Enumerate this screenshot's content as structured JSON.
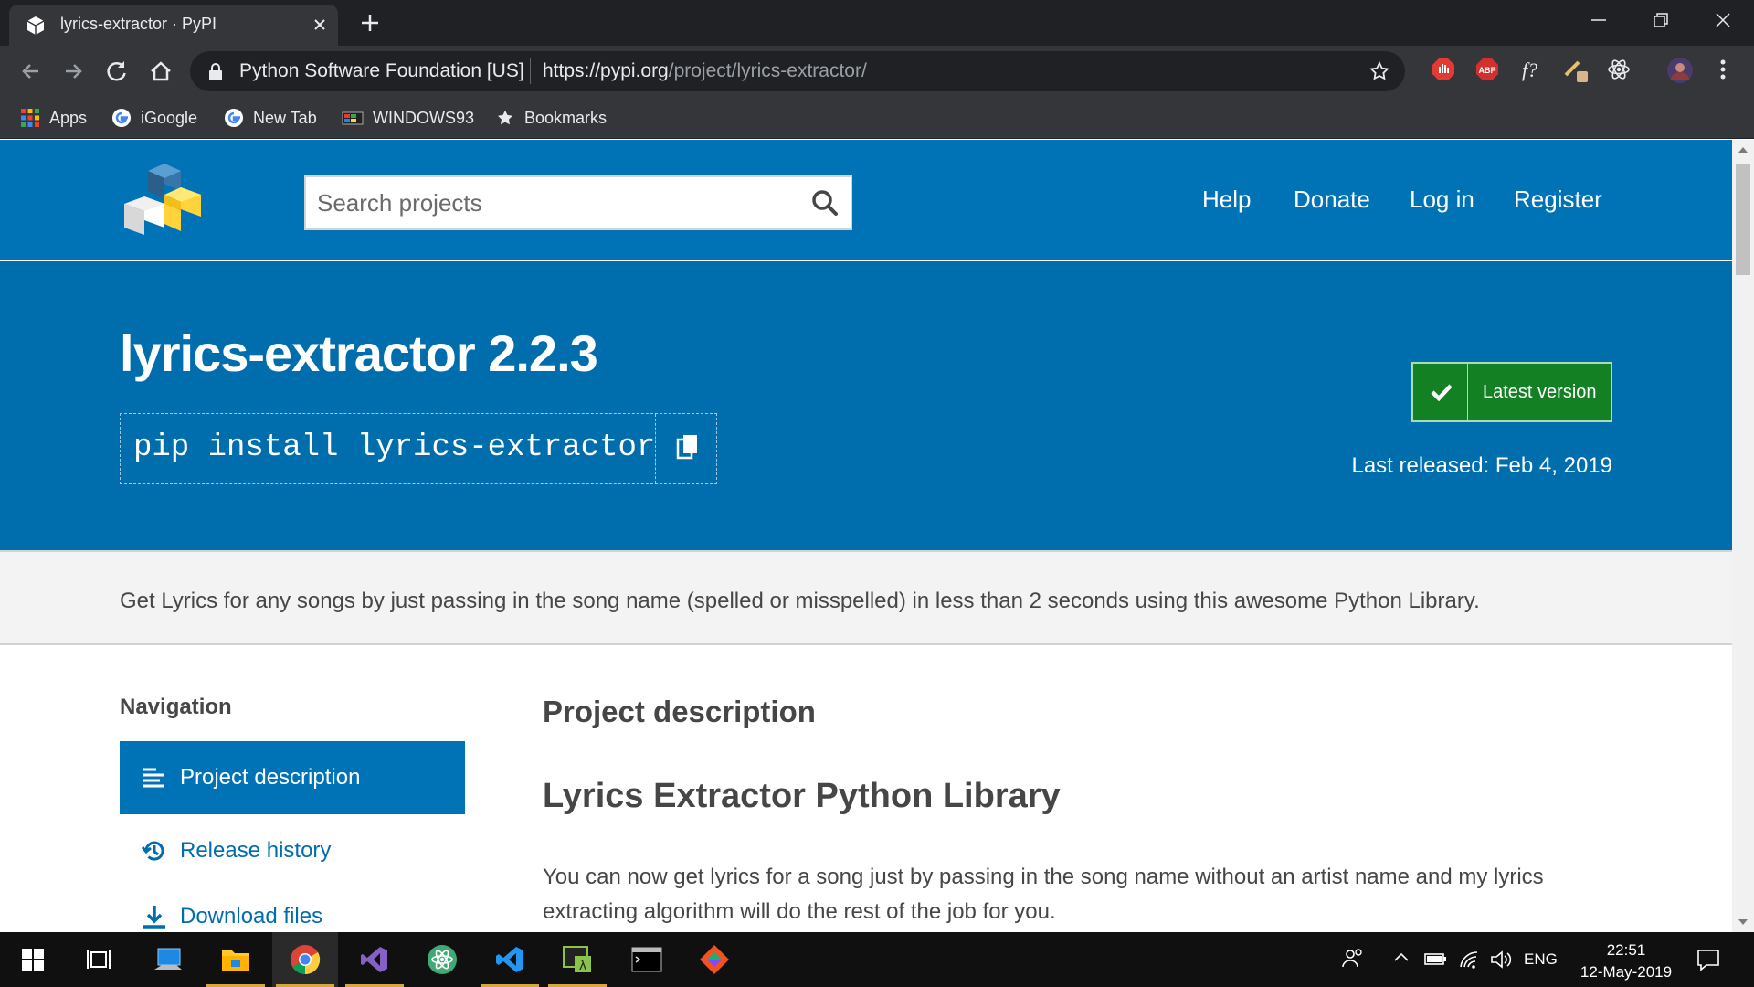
{
  "browser": {
    "tab_title": "lyrics-extractor · PyPI",
    "site_identity": "Python Software Foundation [US]",
    "url_host": "https://pypi.org",
    "url_path": "/project/lyrics-extractor/",
    "bookmarks": [
      "Apps",
      "iGoogle",
      "New Tab",
      "WINDOWS93",
      "Bookmarks"
    ],
    "extensions": [
      "adblock-icon",
      "abp-icon",
      "font-detect-icon",
      "tools-icon",
      "react-icon",
      "profile-avatar"
    ]
  },
  "header": {
    "search_placeholder": "Search projects",
    "nav": [
      "Help",
      "Donate",
      "Log in",
      "Register"
    ]
  },
  "package": {
    "name_version": "lyrics-extractor 2.2.3",
    "pip_command": "pip install lyrics-extractor",
    "latest_label": "Latest version",
    "released": "Last released: Feb 4, 2019",
    "summary": "Get Lyrics for any songs by just passing in the song name (spelled or misspelled) in less than 2 seconds using this awesome Python Library."
  },
  "sidebar": {
    "heading": "Navigation",
    "items": [
      {
        "label": "Project description",
        "icon": "align-left-icon",
        "active": true
      },
      {
        "label": "Release history",
        "icon": "history-icon",
        "active": false
      },
      {
        "label": "Download files",
        "icon": "download-icon",
        "active": false
      }
    ]
  },
  "content": {
    "section_title": "Project description",
    "readme_title": "Lyrics Extractor Python Library",
    "readme_text": "You can now get lyrics for a song just by passing in the song name without an artist name and my lyrics extracting algorithm will do the rest of the job for you."
  },
  "taskbar": {
    "apps": [
      "start-icon",
      "task-view-icon",
      "computer-icon",
      "file-explorer-icon",
      "chrome-icon",
      "visual-studio-icon",
      "atom-icon",
      "vscode-icon",
      "cmder-icon",
      "terminal-icon",
      "git-icon"
    ],
    "language": "ENG",
    "time": "22:51",
    "date": "12-May-2019"
  },
  "colors": {
    "pypi_blue": "#0073b7",
    "banner_blue": "#006dad",
    "latest_green": "#148024"
  }
}
